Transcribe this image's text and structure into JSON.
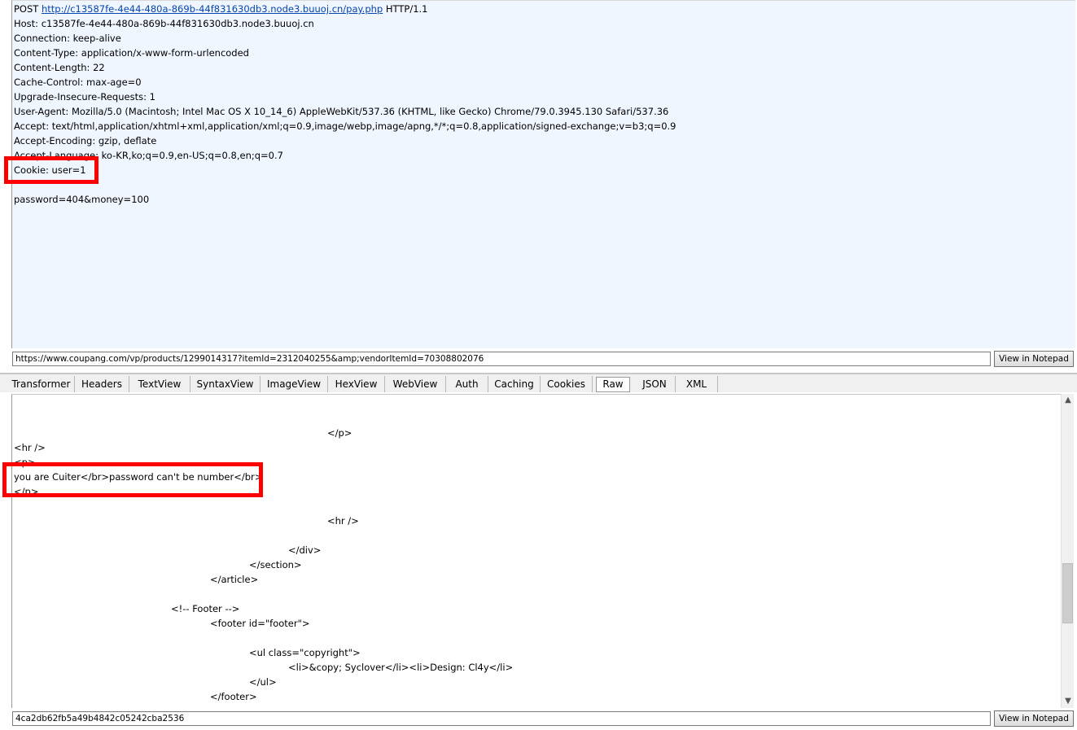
{
  "request": {
    "method": "POST",
    "url": "http://c13587fe-4e44-480a-869b-44f831630db3.node3.buuoj.cn/pay.php",
    "protocol": "HTTP/1.1",
    "headers": [
      "Host: c13587fe-4e44-480a-869b-44f831630db3.node3.buuoj.cn",
      "Connection: keep-alive",
      "Content-Type: application/x-www-form-urlencoded",
      "Content-Length: 22",
      "Cache-Control: max-age=0",
      "Upgrade-Insecure-Requests: 1",
      "User-Agent: Mozilla/5.0 (Macintosh; Intel Mac OS X 10_14_6) AppleWebKit/537.36 (KHTML, like Gecko) Chrome/79.0.3945.130 Safari/537.36",
      "Accept: text/html,application/xhtml+xml,application/xml;q=0.9,image/webp,image/apng,*/*;q=0.8,application/signed-exchange;v=b3;q=0.9",
      "Accept-Encoding: gzip, deflate",
      "Accept-Language: ko-KR,ko;q=0.9,en-US;q=0.8,en;q=0.7",
      "Cookie: user=1"
    ],
    "body": "password=404&money=100"
  },
  "request_address": "https://www.coupang.com/vp/products/1299014317?itemId=2312040255&amp;vendorItemId=70308802076",
  "view_in_notepad_label": "View in Notepad",
  "tabs": [
    {
      "label": "Transformer"
    },
    {
      "label": "Headers"
    },
    {
      "label": "TextView"
    },
    {
      "label": "SyntaxView"
    },
    {
      "label": "ImageView"
    },
    {
      "label": "HexView"
    },
    {
      "label": "WebView"
    },
    {
      "label": "Auth"
    },
    {
      "label": "Caching"
    },
    {
      "label": "Cookies"
    },
    {
      "label": "Raw"
    },
    {
      "label": "JSON"
    },
    {
      "label": "XML"
    }
  ],
  "active_tab": "Raw",
  "response_lines": [
    "</p>",
    "<hr />",
    "<p>",
    "you are Cuiter</br>password can't be number</br>",
    "</p>",
    "<hr />",
    "</div>",
    "</section>",
    "</article>",
    "<!-- Footer -->",
    "<footer id=\"footer\">",
    "<ul class=\"copyright\">",
    "<li>&copy; Syclover</li><li>Design: Cl4y</li>",
    "</ul>",
    "</footer>"
  ],
  "response_address": "4ca2db62fb5a49b4842c05242cba2536",
  "colors": {
    "highlight": "#ff0000",
    "link": "#0645ad",
    "request_bg": "#f0f6ff"
  },
  "icons": {
    "scroll_up": "chevron-up-icon",
    "scroll_down": "chevron-down-icon"
  }
}
